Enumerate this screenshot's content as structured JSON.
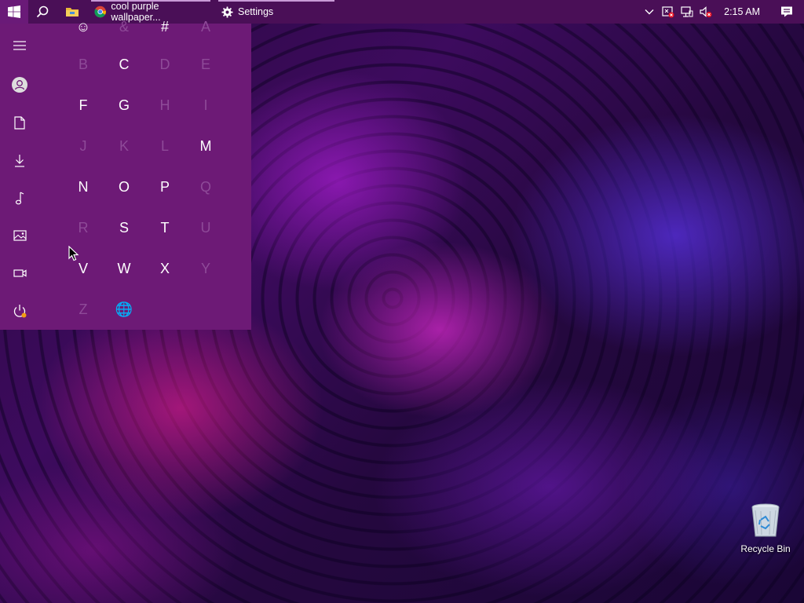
{
  "taskbar": {
    "apps": [
      {
        "label": "cool purple wallpaper...",
        "icon": "chrome-icon"
      },
      {
        "label": "Settings",
        "icon": "gear-icon"
      }
    ],
    "clock": "2:15 AM"
  },
  "start_menu": {
    "letters": [
      {
        "label": "☺",
        "enabled": true
      },
      {
        "label": "&",
        "enabled": false
      },
      {
        "label": "#",
        "enabled": true
      },
      {
        "label": "A",
        "enabled": false
      },
      {
        "label": "B",
        "enabled": false
      },
      {
        "label": "C",
        "enabled": true
      },
      {
        "label": "D",
        "enabled": false
      },
      {
        "label": "E",
        "enabled": false
      },
      {
        "label": "F",
        "enabled": true
      },
      {
        "label": "G",
        "enabled": true
      },
      {
        "label": "H",
        "enabled": false
      },
      {
        "label": "I",
        "enabled": false
      },
      {
        "label": "J",
        "enabled": false
      },
      {
        "label": "K",
        "enabled": false
      },
      {
        "label": "L",
        "enabled": false
      },
      {
        "label": "M",
        "enabled": true
      },
      {
        "label": "N",
        "enabled": true
      },
      {
        "label": "O",
        "enabled": true
      },
      {
        "label": "P",
        "enabled": true
      },
      {
        "label": "Q",
        "enabled": false
      },
      {
        "label": "R",
        "enabled": false
      },
      {
        "label": "S",
        "enabled": true
      },
      {
        "label": "T",
        "enabled": true
      },
      {
        "label": "U",
        "enabled": false
      },
      {
        "label": "V",
        "enabled": true
      },
      {
        "label": "W",
        "enabled": true
      },
      {
        "label": "X",
        "enabled": true
      },
      {
        "label": "Y",
        "enabled": false
      },
      {
        "label": "Z",
        "enabled": false
      },
      {
        "label": "🌐",
        "enabled": false
      }
    ]
  },
  "desktop": {
    "recycle_bin_label": "Recycle Bin"
  },
  "colors": {
    "taskbar": "#4a0f57",
    "start_menu": "#6d1a76",
    "letter_enabled": "#ffffff",
    "letter_disabled": "#8e4a98"
  }
}
